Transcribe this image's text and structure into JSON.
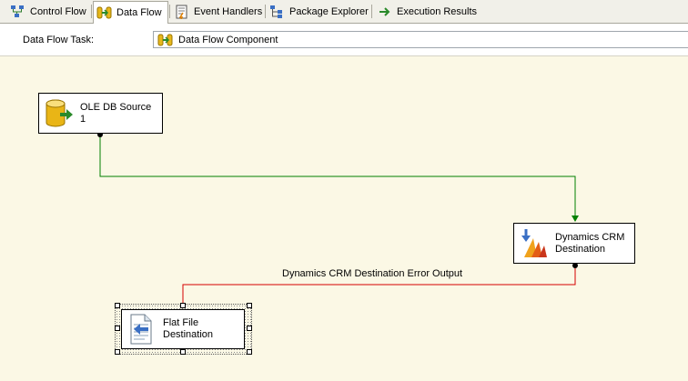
{
  "tabs": [
    {
      "label": "Control Flow",
      "icon": "control-flow-icon",
      "active": false
    },
    {
      "label": "Data Flow",
      "icon": "data-flow-icon",
      "active": true
    },
    {
      "label": "Event Handlers",
      "icon": "event-handlers-icon",
      "active": false
    },
    {
      "label": "Package Explorer",
      "icon": "package-explorer-icon",
      "active": false
    },
    {
      "label": "Execution Results",
      "icon": "execution-results-icon",
      "active": false
    }
  ],
  "task": {
    "label": "Data Flow Task:",
    "value": "Data Flow Component"
  },
  "components": {
    "source": {
      "line1": "OLE DB Source",
      "line2": "1"
    },
    "crm": {
      "line1": "Dynamics CRM",
      "line2": "Destination"
    },
    "flatfile": {
      "line1": "Flat File",
      "line2": "Destination"
    }
  },
  "paths": {
    "error_output_label": "Dynamics CRM Destination Error Output"
  },
  "colors": {
    "canvas": "#fbf8e5",
    "success_path": "#008000",
    "error_path": "#d40000"
  }
}
